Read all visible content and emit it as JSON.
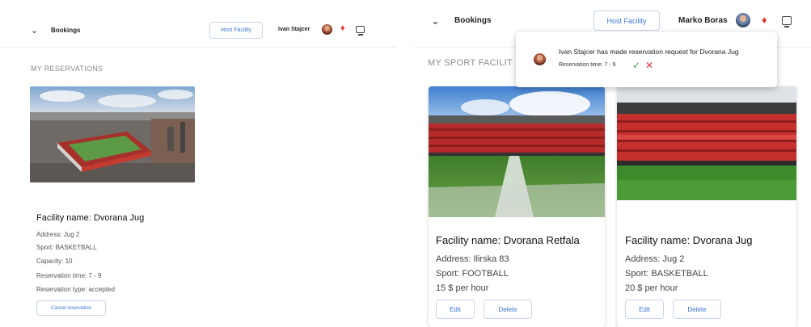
{
  "left": {
    "header": {
      "title": "Bookings",
      "host_button": "Host Facility",
      "user_name": "Ivan Stajcer"
    },
    "section_title": "MY RESERVATIONS",
    "reservation": {
      "facility_name": "Facility name: Dvorana Jug",
      "address": "Address: Jug 2",
      "sport": "Sport: BASKETBALL",
      "capacity": "Capacity: 10",
      "time": "Reservation time: 7 - 9",
      "type": "Reservation type: accepted",
      "cancel_button": "Cancel reservation"
    }
  },
  "right": {
    "header": {
      "title": "Bookings",
      "host_button": "Host Facility",
      "user_name": "Marko Boras"
    },
    "section_title": "MY SPORT FACILIT",
    "notification": {
      "message": "Ivan Stajcer has made reservation request for Dvorana Jug",
      "time": "Reservation time: 7 - 9"
    },
    "facilities": [
      {
        "name": "Facility name: Dvorana Retfala",
        "address": "Address: Ilirska 83",
        "sport": "Sport: FOOTBALL",
        "price": "15 $ per hour",
        "edit": "Edit",
        "delete": "Delete"
      },
      {
        "name": "Facility name: Dvorana Jug",
        "address": "Address: Jug 2",
        "sport": "Sport: BASKETBALL",
        "price": "20 $ per hour",
        "edit": "Edit",
        "delete": "Delete"
      }
    ]
  },
  "icons": {
    "menu": "chevron-down-icon",
    "bell": "bell-icon",
    "display": "monitor-icon",
    "accept": "check-icon",
    "reject": "close-icon"
  },
  "colors": {
    "accent": "#3a78d6",
    "bell": "#e53935",
    "accept": "#43a047",
    "reject": "#e53935"
  }
}
